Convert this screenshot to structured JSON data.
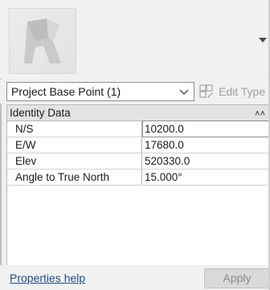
{
  "type_selector": {
    "current": "Project Base Point (1)",
    "edit_type_label": "Edit Type"
  },
  "properties": {
    "group_label": "Identity Data",
    "rows": [
      {
        "name": "N/S",
        "value": "10200.0"
      },
      {
        "name": "E/W",
        "value": "17680.0"
      },
      {
        "name": "Elev",
        "value": "520330.0"
      },
      {
        "name": "Angle to True North",
        "value": "15.000°"
      }
    ]
  },
  "footer": {
    "help_label": "Properties help",
    "apply_label": "Apply"
  },
  "icons": [
    "revit-family-icon",
    "dropdown-arrow-icon",
    "chevron-down-icon",
    "edit-type-icon",
    "collapse-icon"
  ]
}
